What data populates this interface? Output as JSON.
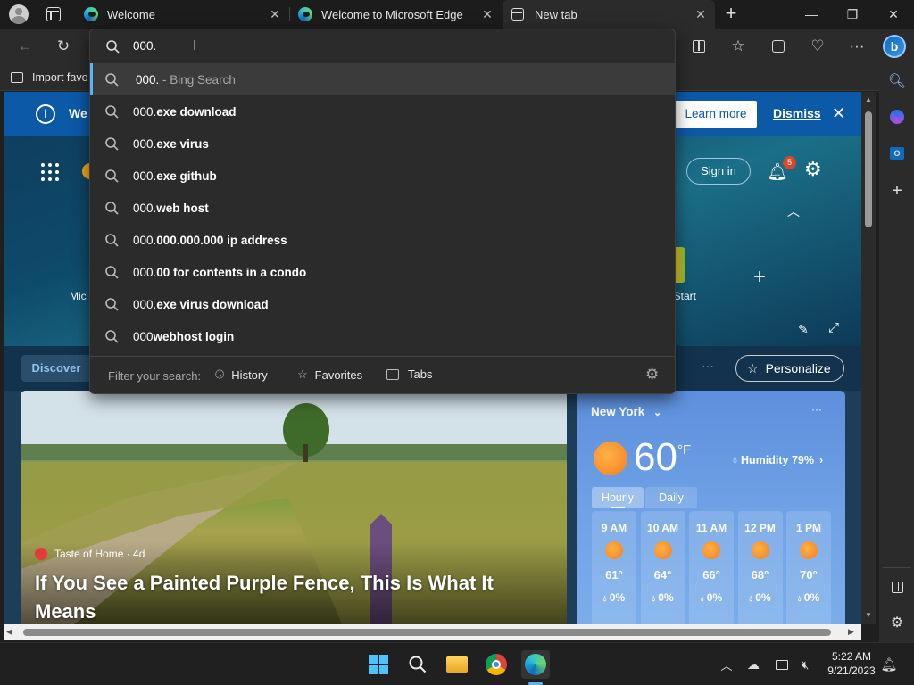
{
  "tabs": [
    {
      "label": "Welcome",
      "close": "✕"
    },
    {
      "label": "Welcome to Microsoft Edge",
      "close": "✕"
    },
    {
      "label": "New tab",
      "close": "✕"
    }
  ],
  "new_tab_glyph": "+",
  "window_controls": {
    "minimize": "—",
    "restore": "❐",
    "close": "✕"
  },
  "address": {
    "value": "000."
  },
  "favorites_bar": {
    "import_label": "Import favo"
  },
  "notice": {
    "partial_text": "We",
    "learn_more": "Learn more",
    "dismiss": "Dismiss"
  },
  "hero": {
    "sign_in": "Sign in",
    "notification_count": "5",
    "left_tile_label": "Mic",
    "right_tile_label": "t Start",
    "add_glyph": "+"
  },
  "feed": {
    "discover": "Discover",
    "more": "···",
    "personalize": "Personalize"
  },
  "suggestions": [
    {
      "typed": "000.",
      "rest": " - Bing Search",
      "bold": false
    },
    {
      "typed": "000.",
      "rest": "exe download",
      "bold": true
    },
    {
      "typed": "000.",
      "rest": "exe virus",
      "bold": true
    },
    {
      "typed": "000.",
      "rest": "exe github",
      "bold": true
    },
    {
      "typed": "000.",
      "rest": "web host",
      "bold": true
    },
    {
      "typed": "000.",
      "rest": "000.000.000 ip address",
      "bold": true
    },
    {
      "typed": "000.",
      "rest": "00 for contents in a condo",
      "bold": true
    },
    {
      "typed": "000.",
      "rest": "exe virus download",
      "bold": true
    },
    {
      "typed": "000",
      "rest": "webhost login",
      "bold": true
    }
  ],
  "filter": {
    "label": "Filter your search:",
    "history": "History",
    "favorites": "Favorites",
    "tabs": "Tabs"
  },
  "news": {
    "source": "Taste of Home · 4d",
    "headline": "If You See a Painted Purple Fence, This Is What It Means"
  },
  "weather": {
    "city": "New York",
    "temp": "60",
    "unit": "°F",
    "humidity": "Humidity 79%",
    "tab_hourly": "Hourly",
    "tab_daily": "Daily",
    "hours": [
      {
        "time": "9 AM",
        "temp": "61°",
        "precip": "0%"
      },
      {
        "time": "10 AM",
        "temp": "64°",
        "precip": "0%"
      },
      {
        "time": "11 AM",
        "temp": "66°",
        "precip": "0%"
      },
      {
        "time": "12 PM",
        "temp": "68°",
        "precip": "0%"
      },
      {
        "time": "1 PM",
        "temp": "70°",
        "precip": "0%"
      }
    ]
  },
  "clock": {
    "time": "5:22 AM",
    "date": "9/21/2023"
  },
  "colors": {
    "accent": "#0c59a8",
    "edge_blue": "#0f6cbd",
    "dropdown_bg": "#2b2b2b",
    "badge": "#d9472b"
  }
}
